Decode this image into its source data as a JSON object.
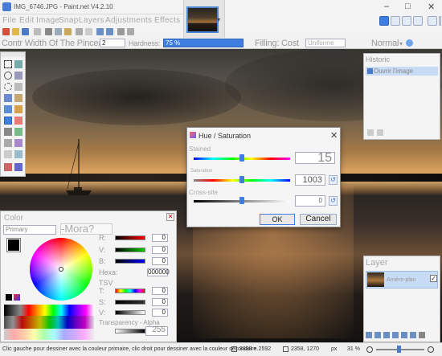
{
  "window": {
    "title": "IMG_6746.JPG - Paint.net V4.2.10",
    "minimize": "–",
    "maximize": "□",
    "close": "✕"
  },
  "menu": [
    "File",
    "Edit",
    "Image",
    "Snap",
    "Layers",
    "Adjustments",
    "Effects"
  ],
  "thumbnail_dropdown": "▾",
  "options_bar": {
    "width_label": "Contr Width Of The Pinceau:",
    "width_value": "2",
    "hardness_label": "Hardness:",
    "hardness_value": "75 %",
    "filling_label": "Filling: Cost",
    "filling_value": "Uniforme",
    "blend_label": "Normal",
    "blend_arrow": "▾"
  },
  "history_panel": {
    "title": "Historic",
    "items": [
      "Ouvrir l'image"
    ]
  },
  "layers_panel": {
    "title": "Layer",
    "items": [
      {
        "name": "Arrière-plan",
        "checked": true
      }
    ]
  },
  "color_panel": {
    "title": "Color",
    "mode": "Primary",
    "more_button": "-Mora?",
    "rgb": [
      {
        "label": "R:",
        "value": "0"
      },
      {
        "label": "V:",
        "value": "0"
      },
      {
        "label": "B:",
        "value": "0"
      }
    ],
    "hex_label": "Hexa:",
    "hex_value": "000000",
    "tsv_label": "TSV",
    "tsv": [
      {
        "label": "T:",
        "value": "0"
      },
      {
        "label": "S:",
        "value": "0"
      },
      {
        "label": "V:",
        "value": "0"
      }
    ],
    "alpha_label": "Transparency - Alpha",
    "alpha_value": "255"
  },
  "dialog": {
    "title": "Hue / Saturation",
    "close": "✕",
    "sliders": [
      {
        "label": "Stained",
        "value": "15"
      },
      {
        "label": "Saturation",
        "value": "1003"
      },
      {
        "label": "Cross-site",
        "value": "0"
      }
    ],
    "ok": "OK",
    "cancel": "Cancel"
  },
  "status_bar": {
    "hint": "Clic gauche pour dessiner avec la couleur primaire, clic droit pour dessiner avec la couleur secondaire.",
    "image_size": "3888 × 2592",
    "cursor_pos": "2358, 1270",
    "unit": "px",
    "zoom": "31 %"
  },
  "colors": {
    "accent": "#3d7ee0",
    "panel": "#f4f4f4",
    "selection": "#c7dcf4"
  }
}
